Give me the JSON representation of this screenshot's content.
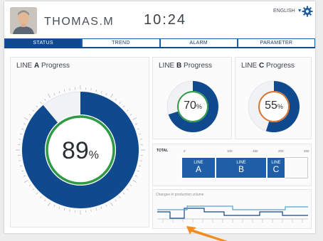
{
  "header": {
    "user_name": "THOMAS.M",
    "time": "10:24",
    "language": "ENGLISH",
    "language_caret": "▼"
  },
  "tabs": [
    {
      "label": "STATUS",
      "active": true
    },
    {
      "label": "TREND",
      "active": false
    },
    {
      "label": "ALARM",
      "active": false
    },
    {
      "label": "PARAMETER",
      "active": false
    }
  ],
  "line_a": {
    "prefix": "LINE",
    "letter": "A",
    "suffix": "Progress",
    "value": 89,
    "unit": "%",
    "ring_color": "#2e9a44"
  },
  "line_b": {
    "prefix": "LINE",
    "letter": "B",
    "suffix": "Progress",
    "value": 70,
    "unit": "%",
    "ring_color": "#2e9a44"
  },
  "line_c": {
    "prefix": "LINE",
    "letter": "C",
    "suffix": "Progress",
    "value": 55,
    "unit": "%",
    "ring_color": "#d9742e"
  },
  "total": {
    "label": "TOTAL",
    "scale": [
      "0",
      "100",
      "150",
      "200",
      "250"
    ],
    "blocks": [
      {
        "line": "LINE",
        "letter": "A"
      },
      {
        "line": "LINE",
        "letter": "B"
      },
      {
        "line": "LINE",
        "letter": "C"
      }
    ]
  },
  "changes": {
    "title": "Changes in production volume"
  },
  "colors": {
    "primary": "#0f4a8f",
    "accent": "#1f5fa8",
    "progress_green": "#2e9a44",
    "progress_orange": "#d9742e",
    "arrow": "#f28c1e"
  }
}
